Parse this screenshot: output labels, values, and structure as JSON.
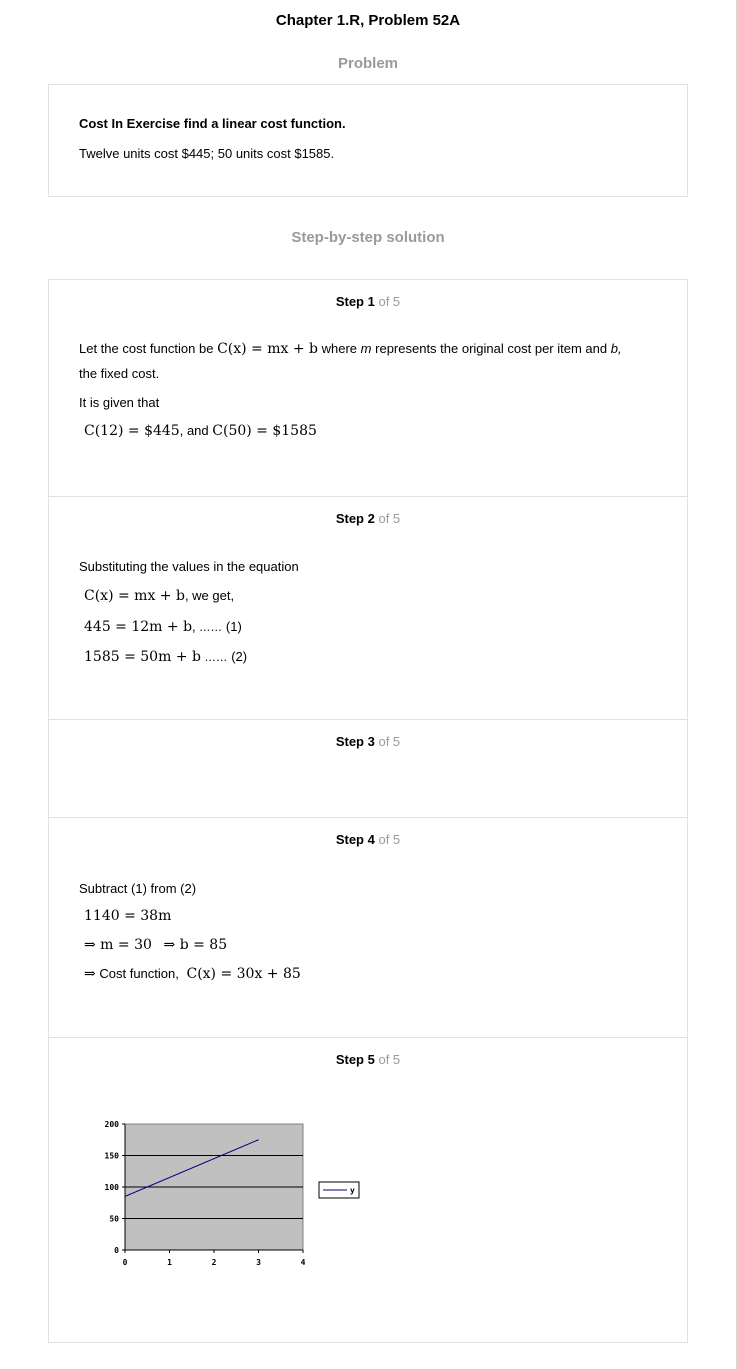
{
  "title": "Chapter 1.R, Problem 52A",
  "problem": {
    "heading": "Problem",
    "statement_bold": "Cost In Exercise find a linear cost function.",
    "statement": "Twelve units cost $445; 50 units cost $1585."
  },
  "solution": {
    "heading": "Step-by-step solution",
    "of_text": "of 5",
    "steps": [
      {
        "label": "Step 1"
      },
      {
        "label": "Step 2"
      },
      {
        "label": "Step 3"
      },
      {
        "label": "Step 4"
      },
      {
        "label": "Step 5"
      }
    ]
  },
  "step1": {
    "t1": "Let the cost function be",
    "eq1": "C(x) = mx + b",
    "t2": "where",
    "m": "m",
    "t3": "represents the original cost per item and",
    "b": "b,",
    "t4": "the fixed cost.",
    "t5": "It is given that",
    "eq2": "C(12) = $445",
    "t6": ", and",
    "eq3": "C(50) = $1585"
  },
  "step2": {
    "t1": "Substituting the values in the equation",
    "eq1": "C(x) = mx + b",
    "t2": ", we get,",
    "eq2": "445 = 12m + b",
    "c1": ",",
    "d1": "……",
    "n1": "(1)",
    "eq3": "1585 = 50m + b",
    "d2": "……",
    "n2": "(2)"
  },
  "step4": {
    "t1": "Subtract (1) from (2)",
    "eq1": "1140 = 38m",
    "eq2": "⇒ m = 30",
    "eq3": "⇒ b = 85",
    "arrow": "⇒",
    "t2": "Cost function,",
    "eq4": "C(x) = 30x + 85"
  },
  "chart_data": {
    "type": "line",
    "x": [
      0,
      3
    ],
    "series": [
      {
        "name": "y",
        "values": [
          85,
          175
        ]
      }
    ],
    "xlim": [
      0,
      4
    ],
    "ylim": [
      0,
      200
    ],
    "xticks": [
      0,
      1,
      2,
      3,
      4
    ],
    "yticks": [
      0,
      50,
      100,
      150,
      200
    ],
    "grid": true,
    "legend": "right",
    "colors": {
      "line": "#000080",
      "plot_bg": "#c0c0c0"
    }
  }
}
